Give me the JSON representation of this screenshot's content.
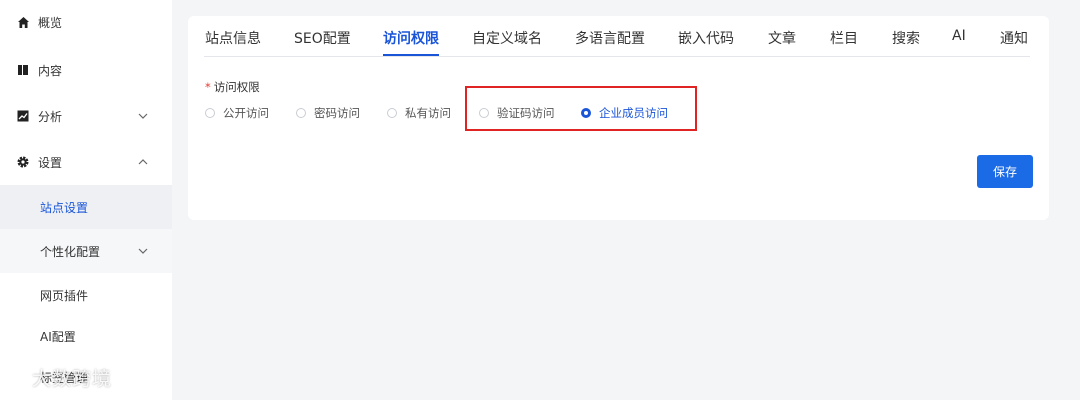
{
  "sidebar": {
    "items": [
      {
        "label": "概览",
        "icon": "home-icon"
      },
      {
        "label": "内容",
        "icon": "book-icon"
      },
      {
        "label": "分析",
        "icon": "chart-icon"
      },
      {
        "label": "设置",
        "icon": "gear-icon"
      },
      {
        "label": "站点设置"
      },
      {
        "label": "个性化配置"
      },
      {
        "label": "网页插件"
      },
      {
        "label": "AI配置"
      },
      {
        "label": "标签管理"
      }
    ]
  },
  "watermark": "大数跨境",
  "tabs": [
    "站点信息",
    "SEO配置",
    "访问权限",
    "自定义域名",
    "多语言配置",
    "嵌入代码",
    "文章",
    "栏目",
    "搜索",
    "AI",
    "通知"
  ],
  "active_tab": "访问权限",
  "form": {
    "label": "访问权限",
    "required_mark": "*",
    "options": [
      "公开访问",
      "密码访问",
      "私有访问",
      "验证码访问",
      "企业成员访问"
    ],
    "selected": "企业成员访问"
  },
  "save_label": "保存",
  "colors": {
    "accent": "#1a55d8",
    "button": "#1c6be6",
    "highlight": "#e02424"
  }
}
